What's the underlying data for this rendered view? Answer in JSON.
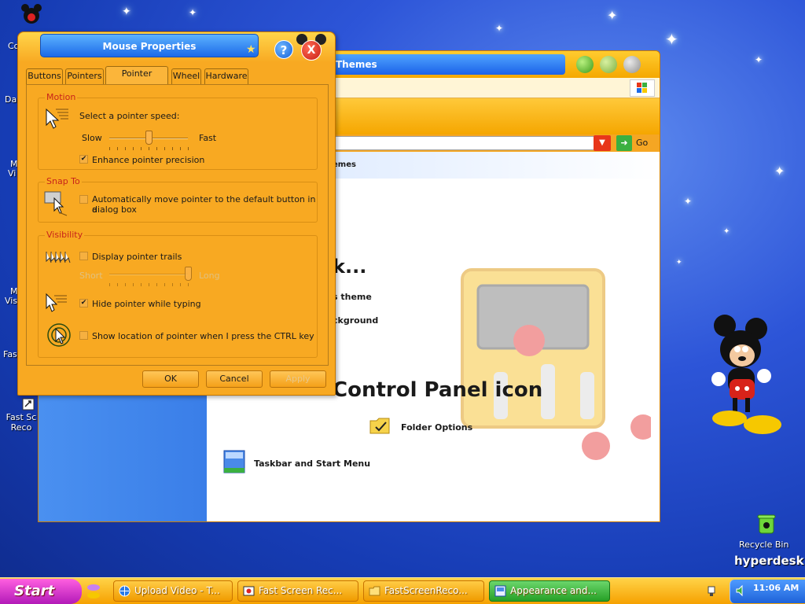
{
  "desktop": {
    "partial_labels": [
      "Co",
      "Da",
      "M",
      "Vi",
      "M",
      "Vis",
      "Fas"
    ],
    "fast_screen_icon_label": "Fast Sc Reco",
    "recycle_bin_label": "Recycle Bin",
    "hyperdesk_logo": "hyperdesk"
  },
  "control_panel": {
    "title": "Themes",
    "go_label": "Go",
    "strip_label": "emes",
    "heading_partial": "k...",
    "task1_partial": "s theme",
    "task2_partial": "ckground",
    "section_partial": "Control Panel icon",
    "folder_options": "Folder Options",
    "taskbar_start_menu": "Taskbar and Start Menu"
  },
  "dialog": {
    "title": "Mouse Properties",
    "help_label": "?",
    "close_label": "X",
    "tabs": [
      "Buttons",
      "Pointers",
      "Pointer Options",
      "Wheel",
      "Hardware"
    ],
    "active_tab": "Pointer Options",
    "motion": {
      "title": "Motion",
      "label": "Select a pointer speed:",
      "slow": "Slow",
      "fast": "Fast",
      "speed_fraction": 0.5,
      "enhance_label": "Enhance pointer precision",
      "enhance_checked": true
    },
    "snap_to": {
      "title": "Snap To",
      "label_line1": "Automatically move pointer to the default button in a",
      "label_line2": "dialog box",
      "checked": false
    },
    "visibility": {
      "title": "Visibility",
      "trails_label": "Display pointer trails",
      "trails_checked": false,
      "short": "Short",
      "long": "Long",
      "trail_fraction": 1.0,
      "hide_label": "Hide pointer while typing",
      "hide_checked": true,
      "show_location_label": "Show location of pointer when I press the CTRL key",
      "show_location_checked": false
    },
    "buttons": {
      "ok": "OK",
      "cancel": "Cancel",
      "apply": "Apply"
    }
  },
  "taskbar": {
    "start": "Start",
    "items": [
      {
        "label": "Upload Video - T...",
        "active": false
      },
      {
        "label": "Fast Screen Rec...",
        "active": false
      },
      {
        "label": "FastScreenReco...",
        "active": false
      },
      {
        "label": "Appearance and...",
        "active": true
      }
    ],
    "clock": "11:06 AM"
  },
  "colors": {
    "accent_orange": "#f8a922",
    "title_blue": "#1c6ae8",
    "close_red": "#c81e12",
    "group_title_red": "#c8241a",
    "active_task_green": "#26a026"
  }
}
